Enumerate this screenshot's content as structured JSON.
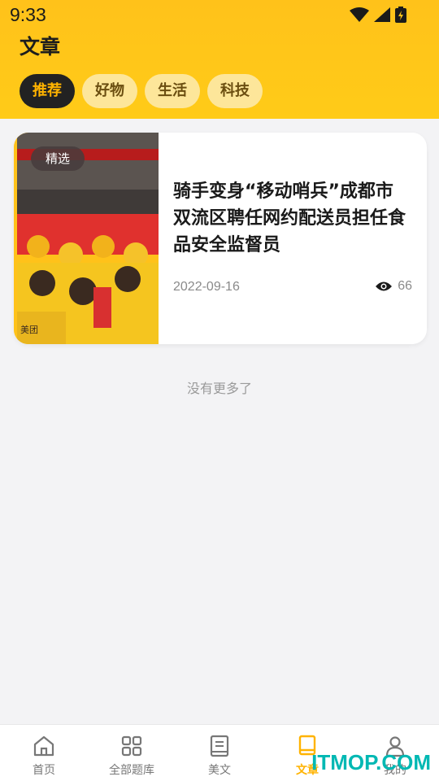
{
  "status_bar": {
    "time": "9:33",
    "icons": [
      "wifi-icon",
      "signal-icon",
      "battery-charging-icon"
    ]
  },
  "header": {
    "title": "文章"
  },
  "tabs": [
    {
      "label": "推荐",
      "active": true
    },
    {
      "label": "好物",
      "active": false
    },
    {
      "label": "生活",
      "active": false
    },
    {
      "label": "科技",
      "active": false
    }
  ],
  "articles": [
    {
      "badge": "精选",
      "title": "骑手变身“移动哨兵”成都市双流区聘任网约配送员担任食品安全监督员",
      "date": "2022-09-16",
      "views": "66",
      "image_text": "美团"
    }
  ],
  "list_footer": "没有更多了",
  "bottom_nav": [
    {
      "label": "首页",
      "icon": "home-icon",
      "active": false
    },
    {
      "label": "全部题库",
      "icon": "grid-icon",
      "active": false
    },
    {
      "label": "美文",
      "icon": "book-icon",
      "active": false
    },
    {
      "label": "文章",
      "icon": "bookmark-book-icon",
      "active": true
    },
    {
      "label": "我的",
      "icon": "user-icon",
      "active": false
    }
  ],
  "watermark": "ITMOP.COM",
  "colors": {
    "accent": "#ffc21a",
    "active_tab_text": "#ffb300",
    "active_tab_bg": "#222222"
  }
}
